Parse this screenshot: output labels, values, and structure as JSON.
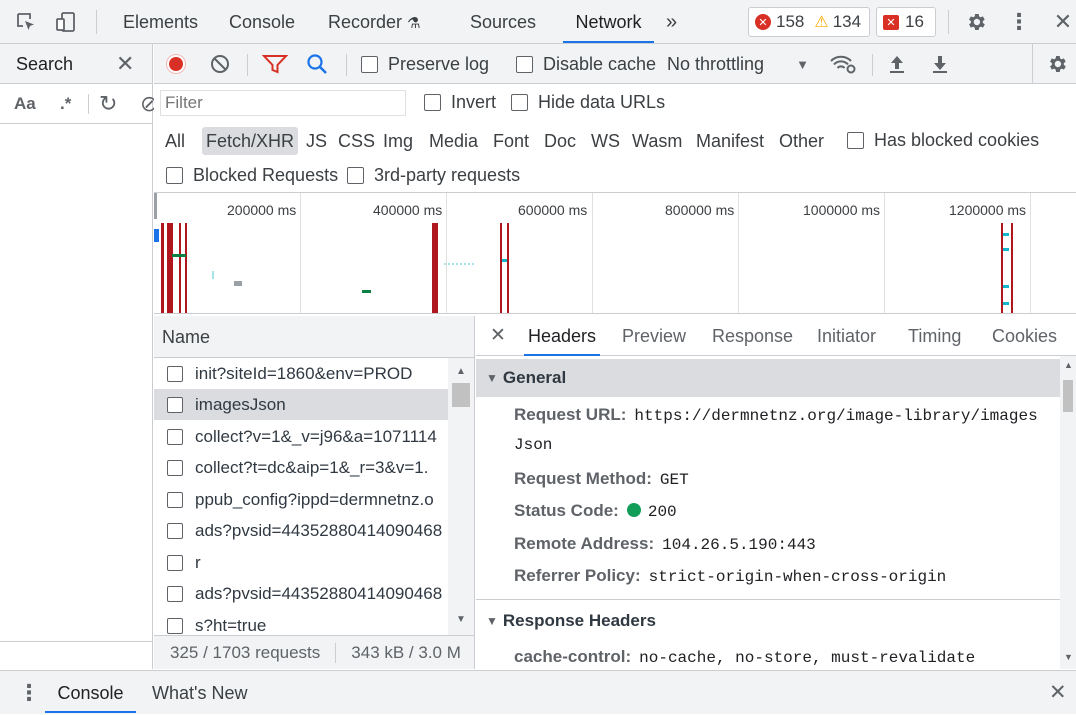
{
  "topbar": {
    "tabs": [
      "Elements",
      "Console",
      "Recorder",
      "Sources",
      "Network"
    ],
    "active_tab": "Network",
    "errors": "158",
    "warnings": "134",
    "issues": "16"
  },
  "search_panel": {
    "title": "Search",
    "case_label": "Aa",
    "regex_label": ".*"
  },
  "toolbar": {
    "preserve_log": "Preserve log",
    "disable_cache": "Disable cache",
    "throttling": "No throttling"
  },
  "filter": {
    "placeholder": "Filter",
    "invert": "Invert",
    "hide_data_urls": "Hide data URLs",
    "types": [
      "All",
      "Fetch/XHR",
      "JS",
      "CSS",
      "Img",
      "Media",
      "Font",
      "Doc",
      "WS",
      "Wasm",
      "Manifest",
      "Other"
    ],
    "selected_type": "Fetch/XHR",
    "has_blocked_cookies": "Has blocked cookies",
    "blocked_requests": "Blocked Requests",
    "third_party": "3rd-party requests"
  },
  "overview": {
    "labels": [
      "200000 ms",
      "400000 ms",
      "600000 ms",
      "800000 ms",
      "1000000 ms",
      "1200000 ms"
    ]
  },
  "requests": {
    "column": "Name",
    "rows": [
      "init?siteId=1860&env=PROD",
      "imagesJson",
      "collect?v=1&_v=j96&a=1071114",
      "collect?t=dc&aip=1&_r=3&v=1.",
      "ppub_config?ippd=dermnetnz.o",
      "ads?pvsid=44352880414090468",
      "r",
      "ads?pvsid=44352880414090468",
      "s?ht=true"
    ],
    "selected_index": 1,
    "count": "325 / 1703 requests",
    "size": "343 kB / 3.0 M"
  },
  "details": {
    "tabs": [
      "Headers",
      "Preview",
      "Response",
      "Initiator",
      "Timing",
      "Cookies"
    ],
    "active_tab": "Headers",
    "general_title": "General",
    "request_url_key": "Request URL:",
    "request_url_line1": "https://dermnetnz.org/image-library/images",
    "request_url_line2": "Json",
    "method_key": "Request Method:",
    "method": "GET",
    "status_key": "Status Code:",
    "status": "200",
    "remote_key": "Remote Address:",
    "remote": "104.26.5.190:443",
    "referrer_key": "Referrer Policy:",
    "referrer": "strict-origin-when-cross-origin",
    "response_headers_title": "Response Headers",
    "cache_key": "cache-control:",
    "cache": "no-cache, no-store, must-revalidate"
  },
  "drawer": {
    "tabs": [
      "Console",
      "What's New"
    ],
    "active_tab": "Console"
  },
  "colors": {
    "accent": "#1a73e8",
    "record": "#d93025",
    "error": "#d93025",
    "warning": "#f9ab00",
    "status_ok": "#0f9d58",
    "overview_bar": "#b0161d"
  }
}
